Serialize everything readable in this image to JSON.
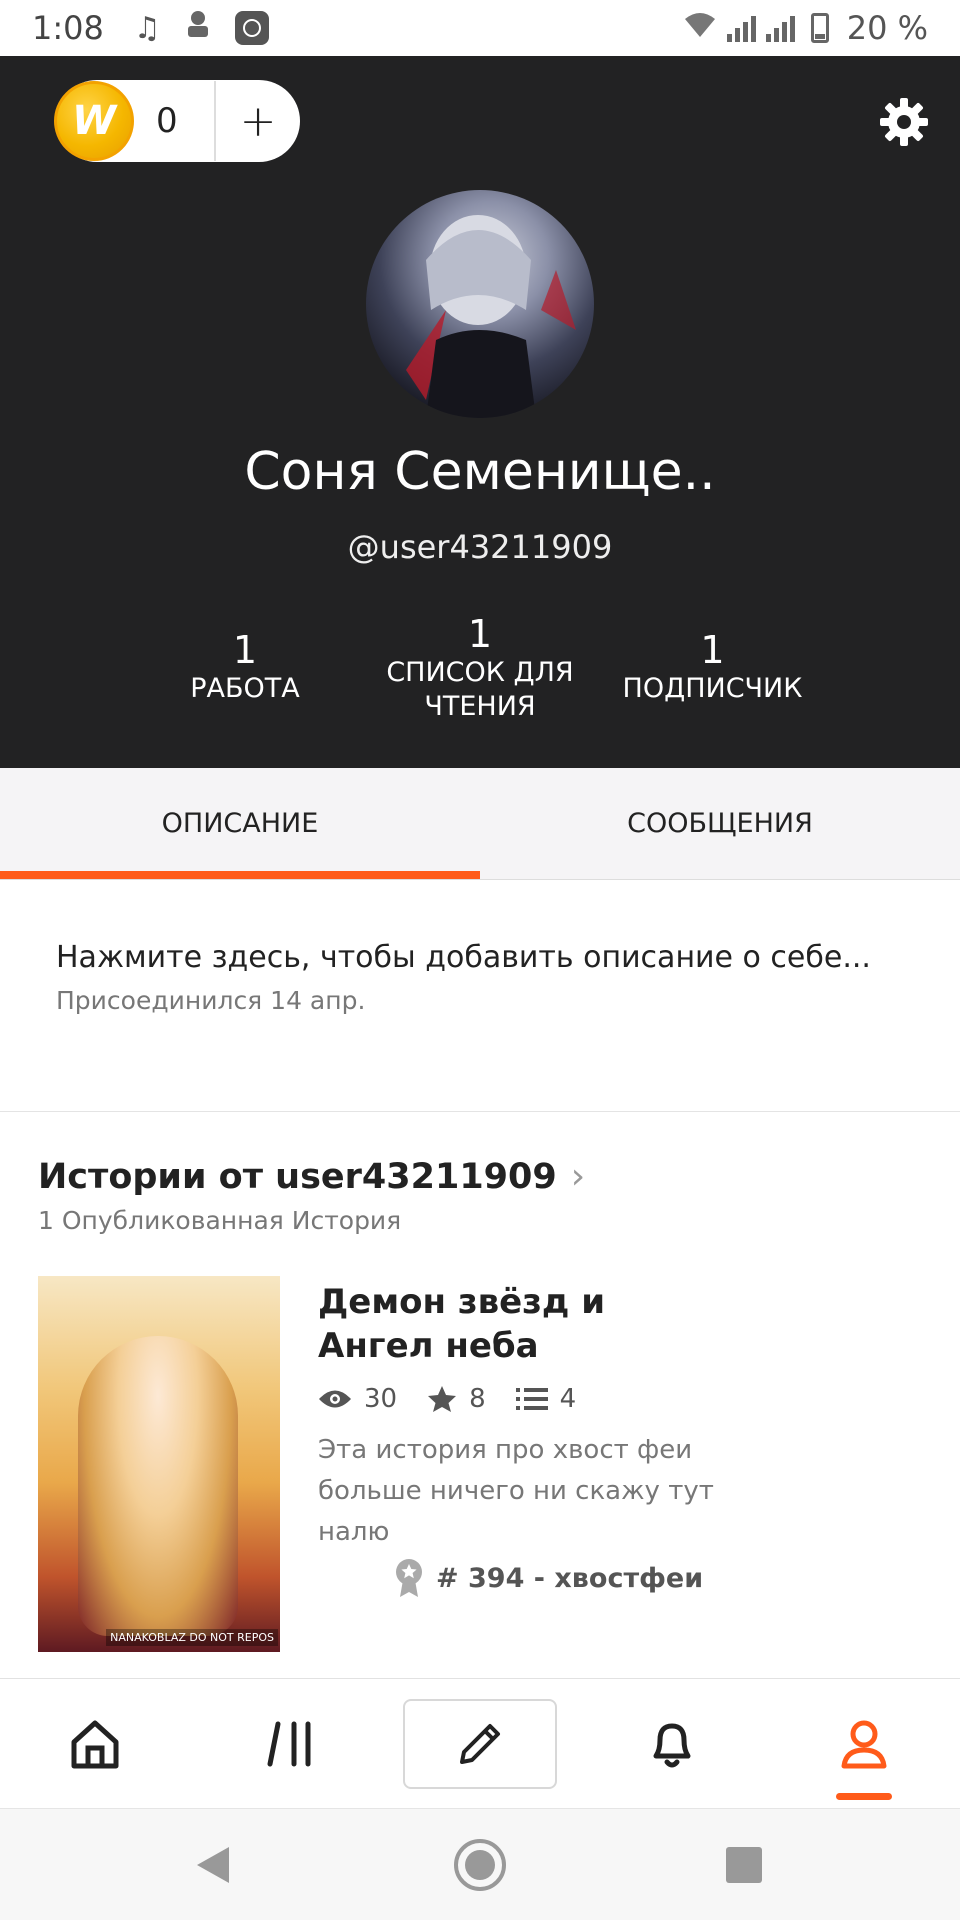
{
  "status_bar": {
    "time": "1:08",
    "battery": "20 %"
  },
  "header": {
    "coins": "0",
    "coin_plus": "+",
    "coin_logo": "W",
    "display_name": "Соня Семенище..",
    "username": "@user43211909",
    "stats": [
      {
        "count": "1",
        "label": "РАБОТА"
      },
      {
        "count": "1",
        "label": "СПИСОК ДЛЯ ЧТЕНИЯ"
      },
      {
        "count": "1",
        "label": "ПОДПИСЧИК"
      }
    ]
  },
  "tabs": [
    {
      "label": "ОПИСАНИЕ",
      "active": true
    },
    {
      "label": "СООБЩЕНИЯ",
      "active": false
    }
  ],
  "about": {
    "prompt": "Нажмите здесь, чтобы добавить описание о себе...",
    "joined": "Присоединился 14 апр."
  },
  "stories": {
    "title": "Истории от user43211909",
    "subtitle": "1 Опубликованная История",
    "items": [
      {
        "title": "Демон звёзд и Ангел неба",
        "reads": "30",
        "votes": "8",
        "parts": "4",
        "description": "Эта история про хвост феи больше ничего ни скажу тут налю",
        "rank": "# 394 - хвостфеи",
        "cover_watermark": "NANAKOBLAZ DO NOT REPOS"
      }
    ]
  },
  "bottom_nav": [
    "home-icon",
    "library-icon",
    "write-icon",
    "notifications-icon",
    "profile-icon"
  ],
  "colors": {
    "accent": "#ff5b1a",
    "header_bg": "#222223"
  }
}
